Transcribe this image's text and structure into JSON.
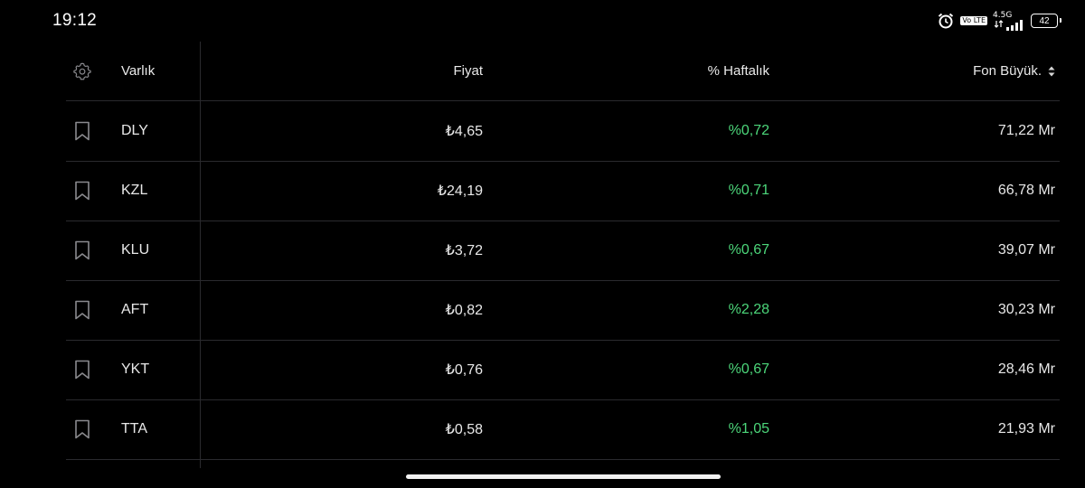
{
  "status_bar": {
    "time": "19:12",
    "network": "4.5G",
    "volte": "Vo LTE",
    "battery": "42"
  },
  "table": {
    "columns": {
      "asset": "Varlık",
      "price": "Fiyat",
      "weekly": "% Haftalık",
      "fund_size": "Fon Büyük."
    },
    "rows": [
      {
        "asset": "DLY",
        "price": "₺4,65",
        "weekly": "%0,72",
        "fund_size": "71,22 Mr"
      },
      {
        "asset": "KZL",
        "price": "₺24,19",
        "weekly": "%0,71",
        "fund_size": "66,78 Mr"
      },
      {
        "asset": "KLU",
        "price": "₺3,72",
        "weekly": "%0,67",
        "fund_size": "39,07 Mr"
      },
      {
        "asset": "AFT",
        "price": "₺0,82",
        "weekly": "%2,28",
        "fund_size": "30,23 Mr"
      },
      {
        "asset": "YKT",
        "price": "₺0,76",
        "weekly": "%0,67",
        "fund_size": "28,46 Mr"
      },
      {
        "asset": "TTA",
        "price": "₺0,58",
        "weekly": "%1,05",
        "fund_size": "21,93 Mr"
      }
    ]
  },
  "colors": {
    "background": "#000000",
    "positive": "#4cd67a",
    "divider": "#2a2a2e",
    "text": "#e8e8e8"
  },
  "icons": {
    "settings": "gear-icon",
    "bookmark": "bookmark-icon",
    "sort": "sort-icon"
  }
}
